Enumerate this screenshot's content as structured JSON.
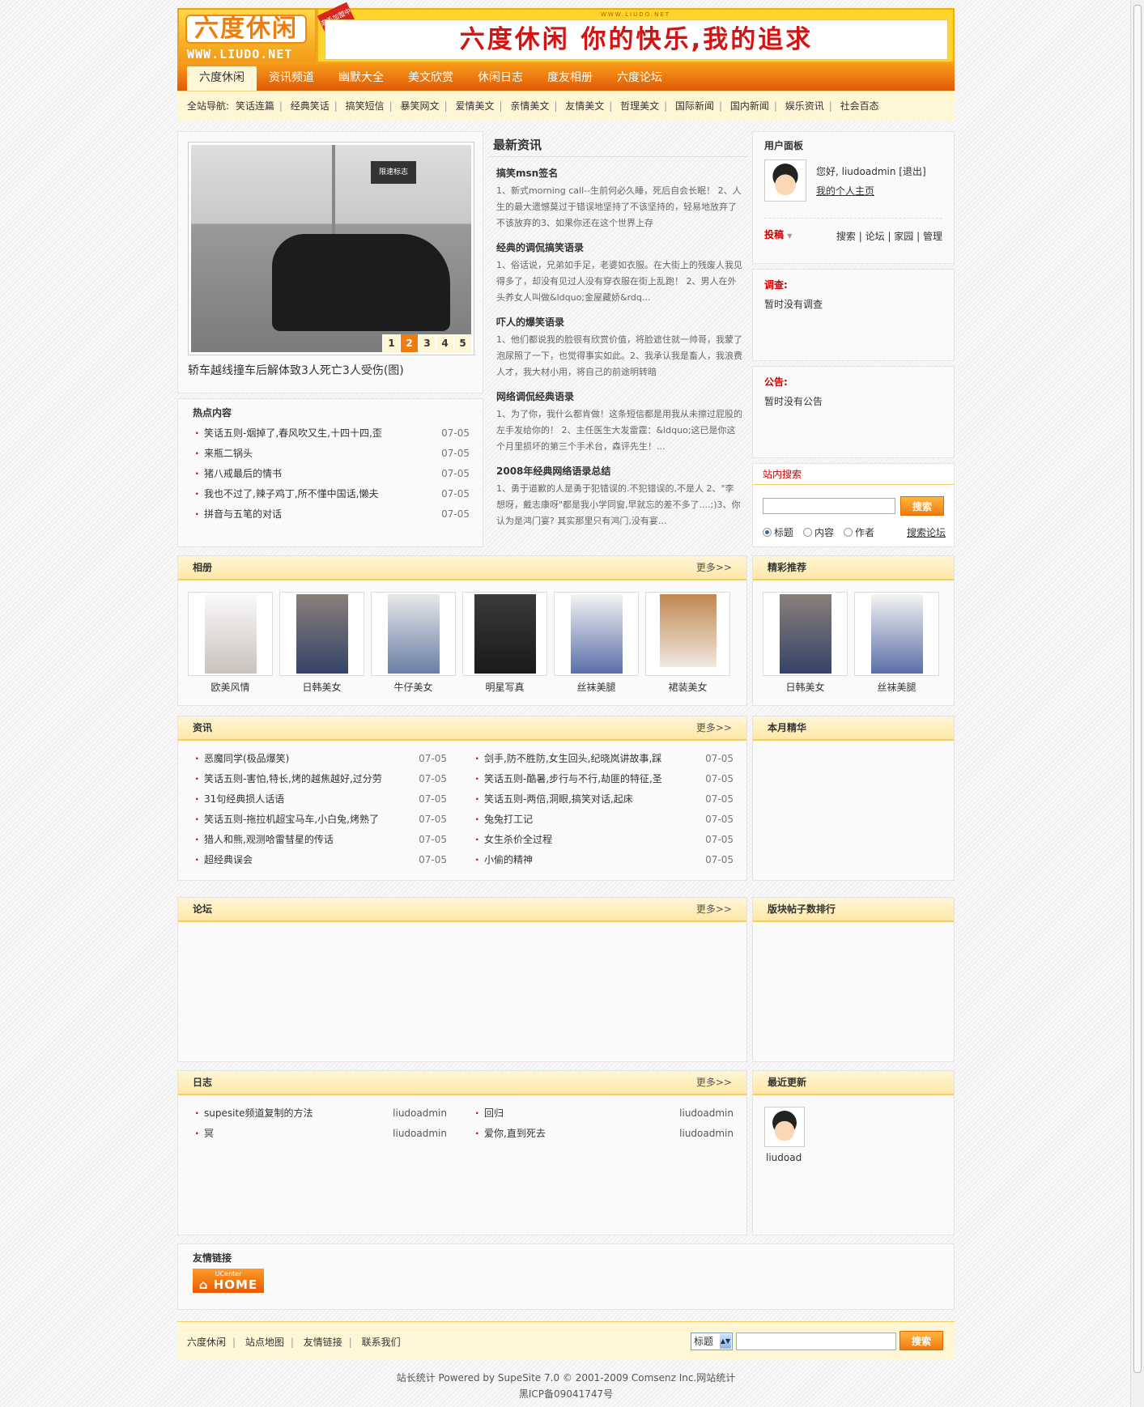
{
  "header": {
    "logo_title": "六度休闲",
    "logo_url": "WWW.LIUDO.NET",
    "banner_stamp": "高手加盟中",
    "banner_url": "WWW.LIUDO.NET",
    "banner_slogan": "六度休闲 你的快乐,我的追求"
  },
  "nav": {
    "tabs": [
      "六度休闲",
      "资讯频道",
      "幽默大全",
      "美文欣赏",
      "休闲日志",
      "度友相册",
      "六度论坛"
    ],
    "active": 0
  },
  "subnav": {
    "label": "全站导航:",
    "items": [
      "笑话连篇",
      "经典笑话",
      "搞笑短信",
      "暴笑网文",
      "爱情美文",
      "亲情美文",
      "友情美文",
      "哲理美文",
      "国际新闻",
      "国内新闻",
      "娱乐资讯",
      "社会百态"
    ]
  },
  "focus": {
    "sign_text": "限速标志",
    "pages": [
      "1",
      "2",
      "3",
      "4",
      "5"
    ],
    "active_page": 1,
    "caption": "轿车越线撞车后解体致3人死亡3人受伤(图)"
  },
  "hot": {
    "title": "热点内容",
    "items": [
      {
        "text": "笑话五则-烟掉了,春风吹又生,十四十四,歪",
        "date": "07-05"
      },
      {
        "text": "来瓶二锅头",
        "date": "07-05"
      },
      {
        "text": "猪八戒最后的情书",
        "date": "07-05"
      },
      {
        "text": "我也不过了,辣子鸡丁,所不懂中国话,懒夫",
        "date": "07-05"
      },
      {
        "text": "拼音与五笔的对话",
        "date": "07-05"
      }
    ]
  },
  "news": {
    "title": "最新资讯",
    "items": [
      {
        "title": "搞笑msn签名",
        "desc": "1、新式morning call--生前何必久睡，死后自会长眠！ 2、人生的最大遗憾莫过于错误地坚持了不该坚持的，轻易地放弃了不该放弃的3、如果你还在这个世界上存"
      },
      {
        "title": "经典的调侃搞笑语录",
        "desc": "1、俗话说，兄弟如手足，老婆如衣服。在大街上的残废人我见得多了，却没有见过人没有穿衣服在街上乱跑！ 2、男人在外头养女人叫做&ldquo;金屋藏娇&rdq..."
      },
      {
        "title": "吓人的爆笑语录",
        "desc": "1、他们都说我的脸很有欣赏价值，将脸遮住就一帅哥，我蒙了泡尿照了一下，也觉得事实如此。2、我承认我是畜人，我浪费人才，我大材小用，将自己的前途明转暗"
      },
      {
        "title": "网络调侃经典语录",
        "desc": "1、为了你，我什么都肯做！这条短信都是用我从未擦过屁股的左手发给你的！ 2、主任医生大发雷霆：&ldquo;这已是你这个月里损坏的第三个手术台，森评先生！..."
      },
      {
        "title": "2008年经典网络语录总结",
        "desc": "1、勇于道歉的人是勇于犯错误的.不犯错误的,不是人 2、\"李想呀，戴志康呀\"都是我小学同窗,早就忘的差不多了....;)3、你认为是鸿门宴? 其实那里只有鸿门,没有宴..."
      }
    ]
  },
  "user": {
    "title": "用户面板",
    "hello": "您好, liudoadmin [退出]",
    "home": "我的个人主页",
    "post": "投稿",
    "links": [
      "搜索",
      "论坛",
      "家园",
      "管理"
    ]
  },
  "survey": {
    "title": "调查:",
    "content": "暂时没有调查"
  },
  "notice": {
    "title": "公告:",
    "content": "暂时没有公告"
  },
  "search": {
    "title": "站内搜索",
    "button": "搜索",
    "options": [
      "标题",
      "内容",
      "作者"
    ],
    "selected": 0,
    "forum_link": "搜索论坛"
  },
  "album": {
    "title": "相册",
    "more": "更多>>",
    "items": [
      "欧美风情",
      "日韩美女",
      "牛仔美女",
      "明星写真",
      "丝袜美腿",
      "裙装美女"
    ]
  },
  "recommend": {
    "title": "精彩推荐",
    "items": [
      "日韩美女",
      "丝袜美腿"
    ]
  },
  "newsbox": {
    "title": "资讯",
    "more": "更多>>",
    "left": [
      {
        "text": "恶魔同学(极品爆笑)",
        "date": "07-05"
      },
      {
        "text": "笑话五则-害怕,特长,烤的越焦越好,过分劳",
        "date": "07-05"
      },
      {
        "text": "31句经典损人话语",
        "date": "07-05"
      },
      {
        "text": "笑话五则-拖拉机超宝马车,小白兔,烤熟了",
        "date": "07-05"
      },
      {
        "text": "猎人和熊,观测哈雷彗星的传话",
        "date": "07-05"
      },
      {
        "text": "超经典误会",
        "date": "07-05"
      }
    ],
    "right": [
      {
        "text": "剑手,防不胜防,女生回头,纪晓岚讲故事,踩",
        "date": "07-05"
      },
      {
        "text": "笑话五则-酷暑,步行与不行,劫匪的特征,圣",
        "date": "07-05"
      },
      {
        "text": "笑话五则-两倍,洞眼,搞笑对话,起床",
        "date": "07-05"
      },
      {
        "text": "兔兔打工记",
        "date": "07-05"
      },
      {
        "text": "女生杀价全过程",
        "date": "07-05"
      },
      {
        "text": "小偷的精神",
        "date": "07-05"
      }
    ]
  },
  "month": {
    "title": "本月精华"
  },
  "forum": {
    "title": "论坛",
    "more": "更多>>"
  },
  "rank": {
    "title": "版块帖子数排行"
  },
  "blog": {
    "title": "日志",
    "more": "更多>>",
    "left": [
      {
        "text": "supesite频道复制的方法",
        "author": "liudoadmin"
      },
      {
        "text": "冥",
        "author": "liudoadmin"
      }
    ],
    "right": [
      {
        "text": "回归",
        "author": "liudoadmin"
      },
      {
        "text": "爱你,直到死去",
        "author": "liudoadmin"
      }
    ]
  },
  "recent": {
    "title": "最近更新",
    "name": "liudoad"
  },
  "links": {
    "title": "友情链接",
    "badge_top": "UCenter",
    "badge_main": "HOME"
  },
  "footer": {
    "links": [
      "六度休闲",
      "站点地图",
      "友情链接",
      "联系我们"
    ],
    "select_value": "标题",
    "button": "搜索",
    "copyright": "站长统计 Powered by SupeSite 7.0 © 2001-2009 Comsenz Inc.网站统计",
    "icp": "黑ICP备09041747号"
  },
  "colors": {
    "accent": "#f07c10",
    "nav": "#e25a06",
    "panel": "#fff6d6",
    "link_red": "#cc0000"
  }
}
